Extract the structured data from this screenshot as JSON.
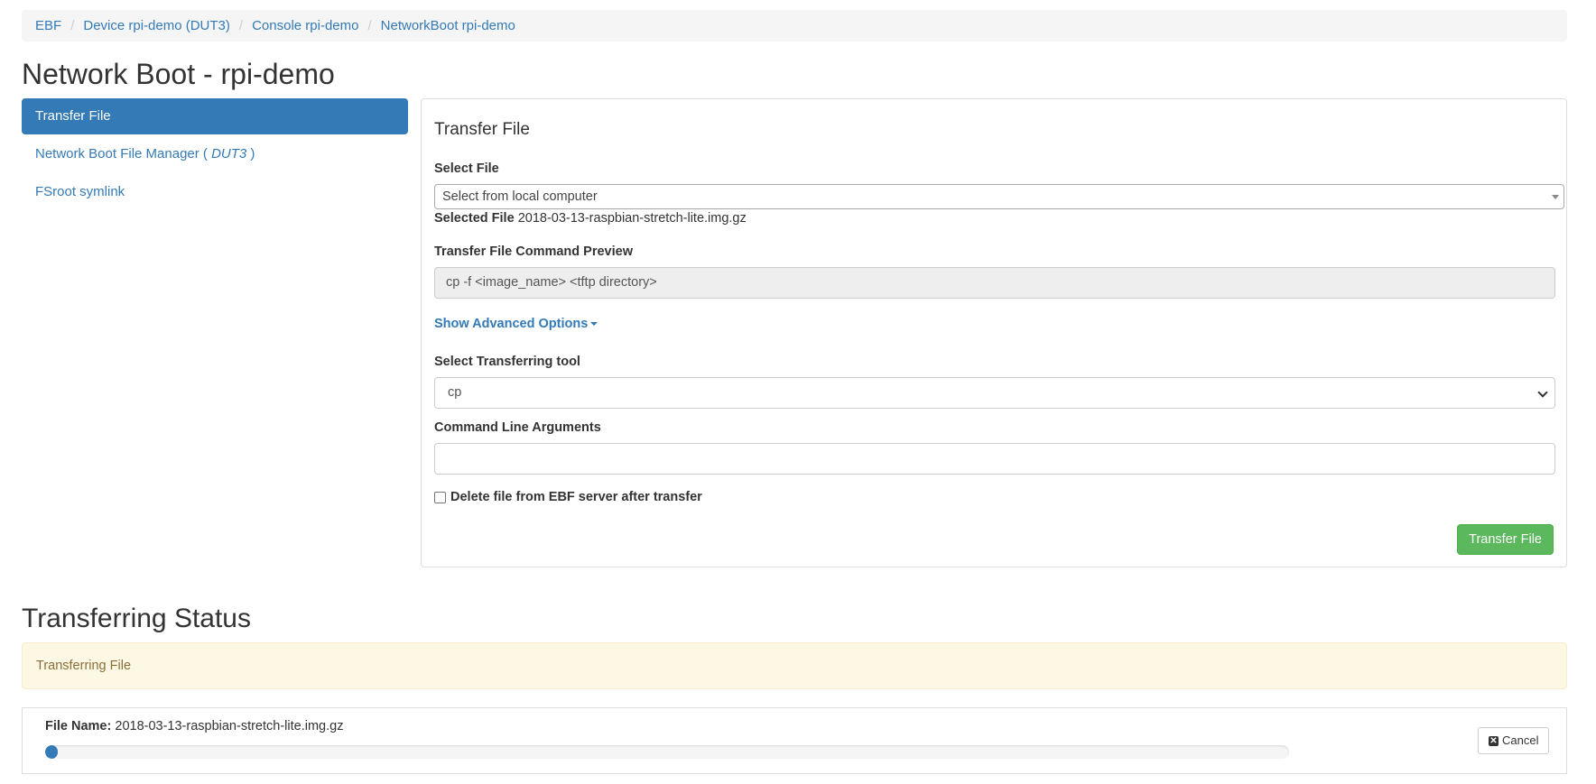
{
  "breadcrumb": [
    "EBF",
    "Device rpi-demo (DUT3)",
    "Console rpi-demo",
    "NetworkBoot rpi-demo"
  ],
  "page_title": "Network Boot - rpi-demo",
  "nav": {
    "transfer_file": "Transfer File",
    "file_manager_prefix": "Network Boot File Manager (",
    "file_manager_device": "DUT3",
    "file_manager_suffix": ")",
    "fsroot_symlink": "FSroot symlink"
  },
  "panel": {
    "title": "Transfer File",
    "select_file_label": "Select File",
    "select_file_value": "Select from local computer",
    "selected_file_label": "Selected File",
    "selected_file_value": "2018-03-13-raspbian-stretch-lite.img.gz",
    "command_preview_label": "Transfer File Command Preview",
    "command_preview_value": "cp -f  <image_name>  <tftp directory>",
    "advanced_options": "Show Advanced Options",
    "tool_label": "Select Transferring tool",
    "tool_value": "cp",
    "args_label": "Command Line Arguments",
    "args_value": "",
    "delete_label": "Delete file from EBF server after transfer",
    "delete_checked": false,
    "transfer_button": "Transfer File"
  },
  "status": {
    "title": "Transferring Status",
    "alert_text": "Transferring File",
    "file_name_label": "File Name:",
    "file_name_value": "2018-03-13-raspbian-stretch-lite.img.gz",
    "progress": 0.01,
    "cancel_button": "Cancel",
    "cancel_icon": "close-icon"
  },
  "colors": {
    "primary": "#337ab7",
    "success": "#5cb85c",
    "warning_bg": "#fcf8e3",
    "warning_text": "#8a6d3b"
  }
}
